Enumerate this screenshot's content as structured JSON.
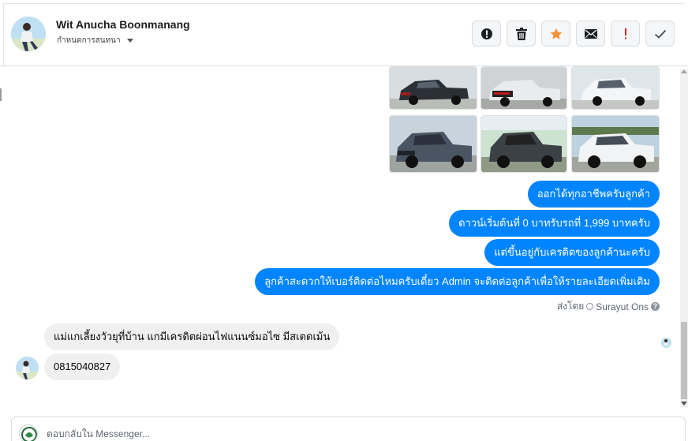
{
  "header": {
    "contact_name": "Wit Anucha Boonmanang",
    "sub_label": "กำหนดการสนทนา",
    "actions": [
      {
        "name": "report-button",
        "icon": "alert-circle-icon"
      },
      {
        "name": "delete-button",
        "icon": "trash-icon"
      },
      {
        "name": "star-button",
        "icon": "star-icon"
      },
      {
        "name": "mark-unread-button",
        "icon": "envelope-icon"
      },
      {
        "name": "flag-important-button",
        "icon": "exclamation-icon"
      },
      {
        "name": "mark-done-button",
        "icon": "checkmark-icon"
      }
    ]
  },
  "messages": {
    "outgoing": [
      "ออกได้ทุกอาชีพครับลูกค้า",
      "ดาวน์เริ่มต้นที่ 0 บาทรับรถที่ 1,999 บาทครับ",
      "แต่ขึ้นอยู่กับเครดิตของลูกค้านะครับ",
      "ลูกค้าสะดวกให้เบอร์ติดต่อไหมครับเดี๋ยว Admin จะติดต่อลูกค้าเพื่อให้รายละเอียดเพิ่มเติม"
    ],
    "sent_by_prefix": "ส่งโดย",
    "sent_by_name": "Surayut Ons",
    "help": "?",
    "incoming": [
      "แม่แกเลี้ยงวัวยุที่บ้าน แกมีเครดิตผ่อนไฟแนนซ์มอไซ มีสเตดเม้น",
      "0815040827"
    ]
  },
  "composer": {
    "placeholder": "ตอบกลับใน Messenger..."
  },
  "colors": {
    "outgoing_bubble": "#0084ff",
    "incoming_bubble": "#f1f0f0",
    "star": "#f7923a",
    "flag": "#e02020"
  }
}
